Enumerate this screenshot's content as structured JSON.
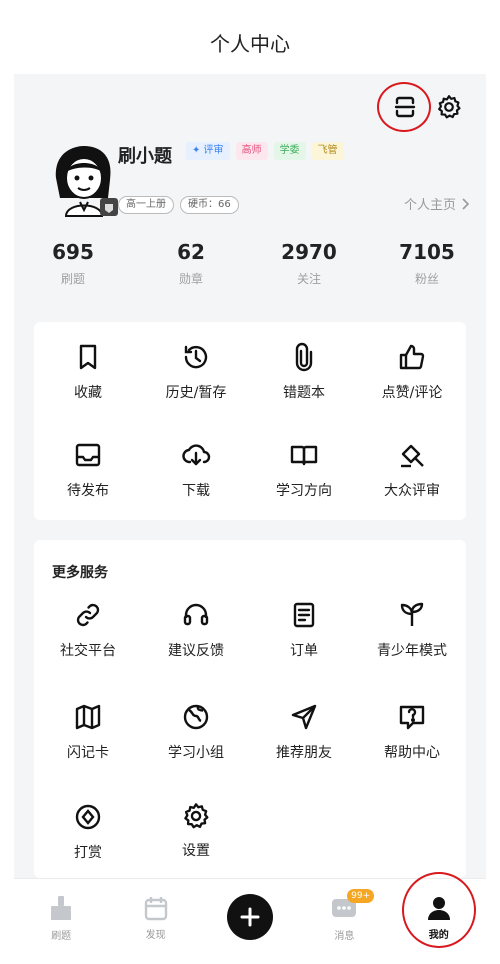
{
  "header": {
    "title": "个人中心"
  },
  "profile": {
    "name": "刷小题",
    "tags": [
      {
        "label": "✦ 评审",
        "color": "#3b82f6",
        "bg": "#e6f0ff"
      },
      {
        "label": "高师",
        "color": "#e04a7a",
        "bg": "#fde7ef"
      },
      {
        "label": "学委",
        "color": "#3fae5a",
        "bg": "#e4f6e8"
      },
      {
        "label": "飞管",
        "color": "#b08a1c",
        "bg": "#fdf5d8"
      }
    ],
    "grade": "高一上册",
    "coins": "硬币：66",
    "homepage": "个人主页"
  },
  "stats": [
    {
      "value": "695",
      "label": "刷题"
    },
    {
      "value": "62",
      "label": "勋章"
    },
    {
      "value": "2970",
      "label": "关注"
    },
    {
      "value": "7105",
      "label": "粉丝"
    }
  ],
  "quick_actions": [
    {
      "label": "收藏",
      "icon": "bookmark-icon"
    },
    {
      "label": "历史/暂存",
      "icon": "history-icon"
    },
    {
      "label": "错题本",
      "icon": "paperclip-icon"
    },
    {
      "label": "点赞/评论",
      "icon": "thumbs-up-icon"
    },
    {
      "label": "待发布",
      "icon": "inbox-icon"
    },
    {
      "label": "下载",
      "icon": "cloud-download-icon"
    },
    {
      "label": "学习方向",
      "icon": "book-icon"
    },
    {
      "label": "大众评审",
      "icon": "gavel-icon"
    }
  ],
  "more_services": {
    "title": "更多服务",
    "items": [
      {
        "label": "社交平台",
        "icon": "link-icon"
      },
      {
        "label": "建议反馈",
        "icon": "headset-icon"
      },
      {
        "label": "订单",
        "icon": "order-icon"
      },
      {
        "label": "青少年模式",
        "icon": "sprout-icon"
      },
      {
        "label": "闪记卡",
        "icon": "map-icon"
      },
      {
        "label": "学习小组",
        "icon": "globe-icon"
      },
      {
        "label": "推荐朋友",
        "icon": "send-icon"
      },
      {
        "label": "帮助中心",
        "icon": "help-icon"
      },
      {
        "label": "打赏",
        "icon": "coin-icon"
      },
      {
        "label": "设置",
        "icon": "settings-icon"
      }
    ]
  },
  "tabbar": {
    "tabs": [
      {
        "label": "刷题",
        "icon": "brush-icon"
      },
      {
        "label": "发现",
        "icon": "calendar-icon"
      },
      {
        "label": "",
        "icon": "plus-icon"
      },
      {
        "label": "消息",
        "icon": "message-icon",
        "badge": "99+"
      },
      {
        "label": "我的",
        "icon": "person-icon",
        "active": true
      }
    ]
  },
  "colors": {
    "highlight_ring": "#d8191e",
    "badge": "#f5a623",
    "background": "#f4f5f7"
  }
}
